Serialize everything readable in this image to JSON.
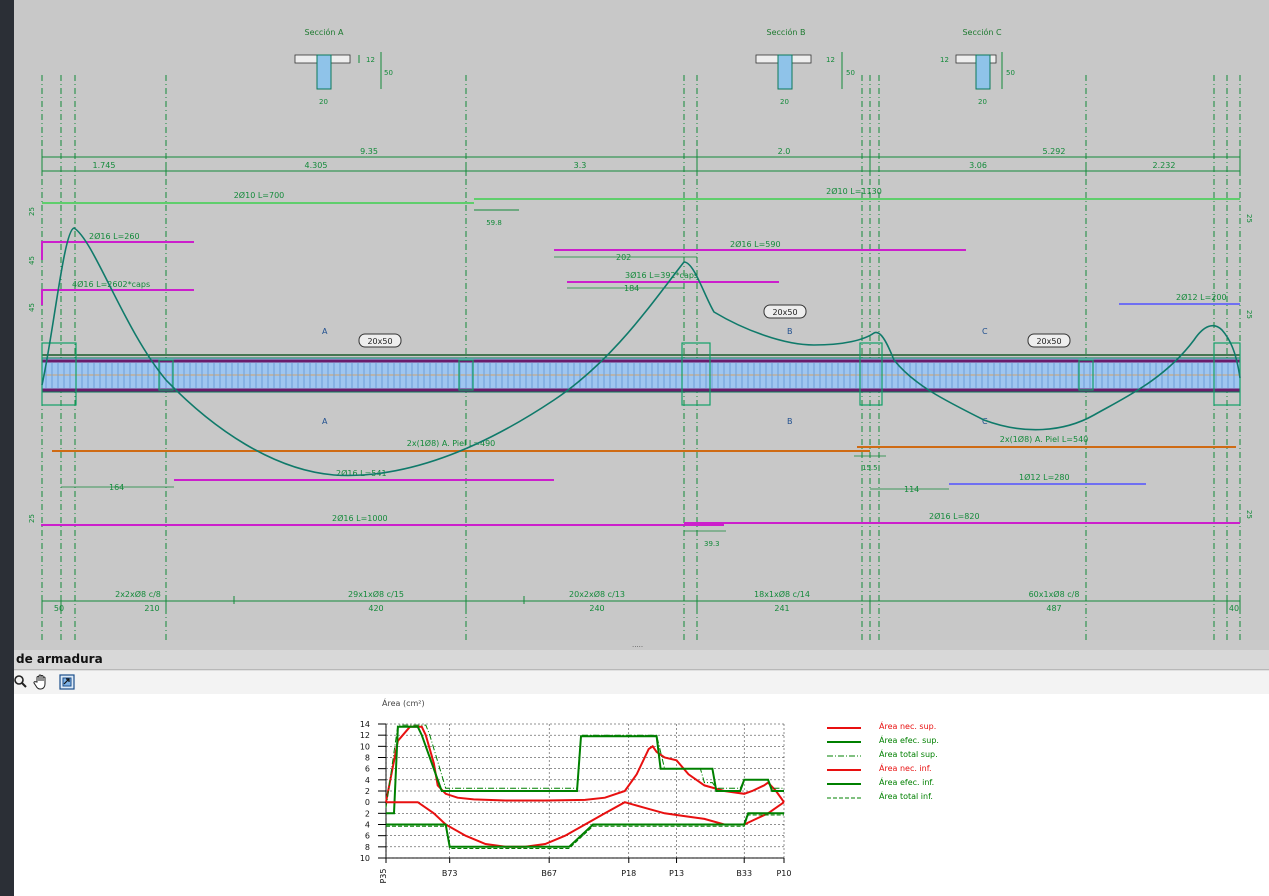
{
  "drawing": {
    "sections": {
      "a_title": "Sección A",
      "b_title": "Sección B",
      "c_title": "Sección C",
      "dim_20": "20",
      "dim_12": "12",
      "dim_50": "50"
    },
    "top_dims": {
      "total_1": "9.35",
      "total_2": "2.0",
      "total_3": "5.292",
      "d1": "1.745",
      "d2": "4.305",
      "d3": "3.3",
      "d4": "3.06",
      "d5": "2.232"
    },
    "rebars": {
      "top_long_1": "2Ø10  L=700",
      "top_long_2": "2Ø10  L=1130",
      "ext_598": "59.8",
      "neg_1": "2Ø16  L=260",
      "neg_2": "4Ø16  L=2602*caps",
      "neg_3": "2Ø16  L=590",
      "neg_4": "3Ø16  L=392*caps",
      "dim_202": "202",
      "dim_184": "184",
      "neg_5": "2Ø12  L=200",
      "skin_1": "2x(1Ø8) A. Piel  L=490",
      "skin_2": "2x(1Ø8) A. Piel  L=540",
      "bot_1": "2Ø16  L=541",
      "dim_164": "164",
      "bot_2": "1Ø12  L=280",
      "dim_114": "114",
      "bot_long_1": "2Ø16  L=1000",
      "bot_long_2": "2Ø16  L=820",
      "ext_393": "39.3",
      "ext_155": "15.5",
      "side_25": "25",
      "side_45": "45"
    },
    "labels": {
      "sec_a": "A",
      "sec_b": "B",
      "sec_c": "C",
      "beam_1": "20x50",
      "beam_2": "20x50",
      "beam_3": "20x50"
    },
    "stirrups": {
      "s1": "2x2xØ8 c/8",
      "s2": "29x1xØ8 c/15",
      "s3": "20x2xØ8 c/13",
      "s4": "18x1xØ8 c/14",
      "s5": "60x1xØ8 c/8",
      "l1": "50",
      "l2": "210",
      "l3": "420",
      "l4": "240",
      "l5": "241",
      "l6": "487",
      "l7": "40"
    }
  },
  "splitter": {
    "grip": "....."
  },
  "panel": {
    "title": "de armadura",
    "tools": [
      "zoom-icon",
      "hand-icon",
      "fit-icon"
    ],
    "legend": [
      {
        "label": "Área nec. sup.",
        "color": "#e81010",
        "style": "solid"
      },
      {
        "label": "Área efec. sup.",
        "color": "#008000",
        "style": "solid"
      },
      {
        "label": "Área total sup.",
        "color": "#008000",
        "style": "dashdot"
      },
      {
        "label": "Área nec. inf.",
        "color": "#e81010",
        "style": "solid"
      },
      {
        "label": "Área efec. inf.",
        "color": "#008000",
        "style": "solid"
      },
      {
        "label": "Área total inf.",
        "color": "#008000",
        "style": "dashed"
      }
    ]
  },
  "chart_data": {
    "type": "line",
    "ylabel": "Área (cm²)",
    "yticks": [
      "14",
      "12",
      "10",
      "8",
      "6",
      "4",
      "2",
      "0",
      "2",
      "4",
      "6",
      "8",
      "10"
    ],
    "xticks": [
      "P35",
      "B73",
      "B67",
      "P18",
      "P13",
      "B33",
      "P10"
    ],
    "ylim": [
      -10,
      14
    ],
    "series": [
      {
        "name": "Área nec. sup.",
        "x": [
          0,
          3,
          6,
          9,
          10,
          12,
          13,
          15,
          18,
          22,
          30,
          40,
          50,
          55,
          60,
          63,
          65,
          66,
          67,
          68,
          70,
          73,
          76,
          80,
          85,
          90,
          92,
          95,
          96,
          98,
          100
        ],
        "y": [
          0,
          11,
          13.5,
          13.5,
          12,
          7,
          3,
          1.5,
          0.8,
          0.5,
          0.3,
          0.3,
          0.4,
          0.8,
          2,
          5,
          8,
          9.5,
          10,
          9,
          8,
          7.5,
          5,
          3,
          2,
          1.5,
          2,
          3,
          3.5,
          2,
          0
        ]
      },
      {
        "name": "Área efec. sup.",
        "x": [
          0,
          2,
          3,
          8,
          9,
          14,
          15,
          44,
          45,
          48,
          49,
          60,
          61,
          68,
          69,
          79,
          80,
          82,
          83,
          89,
          90,
          96,
          97,
          100
        ],
        "y": [
          -2,
          -2,
          13.5,
          13.5,
          12,
          2,
          2,
          2,
          2,
          2,
          11.8,
          11.8,
          11.8,
          11.8,
          6,
          6,
          6,
          6,
          2,
          2,
          4,
          4,
          2,
          2
        ]
      },
      {
        "name": "Área total sup.",
        "x": [
          0,
          3,
          10,
          11,
          15,
          44,
          45,
          48,
          49,
          61,
          62,
          68,
          70,
          79,
          80,
          82,
          83,
          89,
          90,
          96,
          97,
          100
        ],
        "y": [
          -1,
          13.8,
          13.8,
          12,
          2.5,
          2.5,
          2.5,
          2.5,
          12,
          12,
          12,
          12,
          6,
          6,
          3.5,
          3.5,
          2.5,
          2.5,
          4,
          4,
          2.5,
          2.5
        ]
      },
      {
        "name": "Área nec. inf.",
        "x": [
          0,
          4,
          8,
          12,
          15,
          20,
          25,
          30,
          35,
          40,
          45,
          50,
          55,
          60,
          65,
          70,
          75,
          80,
          85,
          90,
          93,
          96,
          100
        ],
        "y": [
          0,
          0,
          0,
          -2,
          -4,
          -6,
          -7.5,
          -8,
          -8,
          -7.5,
          -6,
          -4,
          -2,
          0,
          -1,
          -2,
          -2.5,
          -3,
          -4,
          -4,
          -3,
          -2,
          0
        ]
      },
      {
        "name": "Área efec. inf.",
        "x": [
          0,
          10,
          11,
          15,
          16,
          45,
          46,
          52,
          53,
          90,
          91,
          100
        ],
        "y": [
          -4,
          -4,
          -4,
          -4,
          -8,
          -8,
          -8,
          -4,
          -4,
          -4,
          -2,
          -2
        ]
      },
      {
        "name": "Área total inf.",
        "x": [
          0,
          10,
          11,
          15,
          16,
          45,
          46,
          52,
          53,
          90,
          91,
          100
        ],
        "y": [
          -4.3,
          -4.3,
          -4.3,
          -4.3,
          -8.3,
          -8.3,
          -8.3,
          -4.3,
          -4.3,
          -4.3,
          -2.3,
          -2.3
        ]
      }
    ],
    "grid": true
  }
}
